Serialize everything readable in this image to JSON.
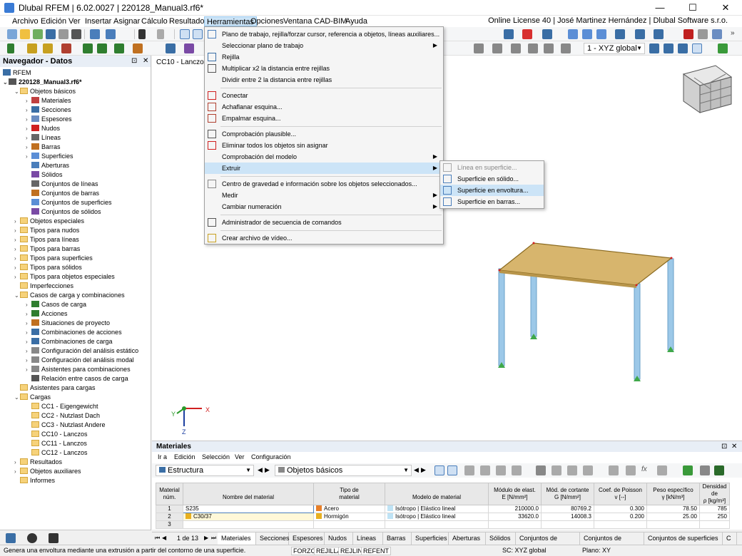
{
  "window": {
    "title": "Dlubal RFEM | 6.02.0027 | 220128_Manual3.rf6*",
    "minimize": "—",
    "maximize": "☐",
    "close": "✕"
  },
  "menubar": {
    "items": [
      "Archivo",
      "Edición",
      "Ver",
      "Insertar",
      "Asignar",
      "Cálculo",
      "Resultados",
      "Herramientas",
      "Opciones",
      "Ventana",
      "CAD-BIM",
      "Ayuda"
    ],
    "license": "Online License 40 | José Martinez Hernández | Dlubal Software s.r.o."
  },
  "toolbar": {
    "coord_system": "1 - XYZ global"
  },
  "navigator": {
    "title": "Navegador - Datos",
    "root": "RFEM",
    "file": "220128_Manual3.rf6*",
    "items": [
      {
        "label": "Objetos básicos",
        "level": 1,
        "exp": "⌄",
        "icon": "folder"
      },
      {
        "label": "Materiales",
        "level": 2,
        "exp": "›",
        "icon": "materials"
      },
      {
        "label": "Secciones",
        "level": 2,
        "exp": "›",
        "icon": "sections"
      },
      {
        "label": "Espesores",
        "level": 2,
        "exp": "›",
        "icon": "thickness"
      },
      {
        "label": "Nudos",
        "level": 2,
        "exp": "›",
        "icon": "node"
      },
      {
        "label": "Líneas",
        "level": 2,
        "exp": "›",
        "icon": "line"
      },
      {
        "label": "Barras",
        "level": 2,
        "exp": "›",
        "icon": "member"
      },
      {
        "label": "Superficies",
        "level": 2,
        "exp": "›",
        "icon": "surface"
      },
      {
        "label": "Aberturas",
        "level": 2,
        "exp": "",
        "icon": "opening"
      },
      {
        "label": "Sólidos",
        "level": 2,
        "exp": "",
        "icon": "solid"
      },
      {
        "label": "Conjuntos de líneas",
        "level": 2,
        "exp": "",
        "icon": "line"
      },
      {
        "label": "Conjuntos de barras",
        "level": 2,
        "exp": "",
        "icon": "member"
      },
      {
        "label": "Conjuntos de superficies",
        "level": 2,
        "exp": "",
        "icon": "surface"
      },
      {
        "label": "Conjuntos de sólidos",
        "level": 2,
        "exp": "",
        "icon": "solid"
      },
      {
        "label": "Objetos especiales",
        "level": 1,
        "exp": "›",
        "icon": "folder"
      },
      {
        "label": "Tipos para nudos",
        "level": 1,
        "exp": "›",
        "icon": "folder"
      },
      {
        "label": "Tipos para líneas",
        "level": 1,
        "exp": "›",
        "icon": "folder"
      },
      {
        "label": "Tipos para barras",
        "level": 1,
        "exp": "›",
        "icon": "folder"
      },
      {
        "label": "Tipos para superficies",
        "level": 1,
        "exp": "›",
        "icon": "folder"
      },
      {
        "label": "Tipos para sólidos",
        "level": 1,
        "exp": "›",
        "icon": "folder"
      },
      {
        "label": "Tipos para objetos especiales",
        "level": 1,
        "exp": "›",
        "icon": "folder"
      },
      {
        "label": "Imperfecciones",
        "level": 1,
        "exp": "",
        "icon": "folder"
      },
      {
        "label": "Casos de carga y combinaciones",
        "level": 1,
        "exp": "⌄",
        "icon": "folder"
      },
      {
        "label": "Casos de carga",
        "level": 2,
        "exp": "›",
        "icon": "loadcase"
      },
      {
        "label": "Acciones",
        "level": 2,
        "exp": "›",
        "icon": "action"
      },
      {
        "label": "Situaciones de proyecto",
        "level": 2,
        "exp": "›",
        "icon": "situation"
      },
      {
        "label": "Combinaciones de acciones",
        "level": 2,
        "exp": "›",
        "icon": "combo"
      },
      {
        "label": "Combinaciones de carga",
        "level": 2,
        "exp": "›",
        "icon": "combo"
      },
      {
        "label": "Configuración del análisis estático",
        "level": 2,
        "exp": "›",
        "icon": "config"
      },
      {
        "label": "Configuración del análisis modal",
        "level": 2,
        "exp": "›",
        "icon": "config"
      },
      {
        "label": "Asistentes para combinaciones",
        "level": 2,
        "exp": "›",
        "icon": "wizard"
      },
      {
        "label": "Relación entre casos de carga",
        "level": 2,
        "exp": "",
        "icon": "relation"
      },
      {
        "label": "Asistentes para cargas",
        "level": 1,
        "exp": "",
        "icon": "folder"
      },
      {
        "label": "Cargas",
        "level": 1,
        "exp": "⌄",
        "icon": "folder"
      },
      {
        "label": "CC1 - Eigengewicht",
        "level": 2,
        "exp": "",
        "icon": "folder"
      },
      {
        "label": "CC2 - Nutzlast Dach",
        "level": 2,
        "exp": "",
        "icon": "folder"
      },
      {
        "label": "CC3 - Nutzlast Andere",
        "level": 2,
        "exp": "",
        "icon": "folder"
      },
      {
        "label": "CC10 - Lanczos",
        "level": 2,
        "exp": "",
        "icon": "folder"
      },
      {
        "label": "CC11 - Lanczos",
        "level": 2,
        "exp": "",
        "icon": "folder"
      },
      {
        "label": "CC12 - Lanczos",
        "level": 2,
        "exp": "",
        "icon": "folder"
      },
      {
        "label": "Resultados",
        "level": 1,
        "exp": "›",
        "icon": "folder"
      },
      {
        "label": "Objetos auxiliares",
        "level": 1,
        "exp": "›",
        "icon": "folder"
      },
      {
        "label": "Informes",
        "level": 1,
        "exp": "",
        "icon": "folder"
      }
    ]
  },
  "viewport": {
    "label": "CC10 - Lanczos",
    "axis_x": "X",
    "axis_y": "Y",
    "axis_z": "Z"
  },
  "tools_menu": {
    "items": [
      {
        "label": "Plano de trabajo, rejilla/forzar cursor, referencia a objetos, líneas auxiliares...",
        "sub": false,
        "icon": "workplane"
      },
      {
        "label": "Seleccionar plano de trabajo",
        "sub": true,
        "icon": ""
      },
      {
        "label": "Rejilla",
        "sub": false,
        "icon": "grid"
      },
      {
        "label": "Multiplicar x2 la distancia entre rejillas",
        "sub": false,
        "icon": "x2"
      },
      {
        "label": "Dividir entre 2 la distancia entre rejillas",
        "sub": false,
        "icon": ""
      },
      {
        "label": "Conectar",
        "sub": false,
        "icon": "connect",
        "sep_before": true
      },
      {
        "label": "Achaflanar esquina...",
        "sub": false,
        "icon": "chamfer"
      },
      {
        "label": "Empalmar esquina...",
        "sub": false,
        "icon": "fillet"
      },
      {
        "label": "Comprobación plausible...",
        "sub": false,
        "icon": "check",
        "sep_before": true
      },
      {
        "label": "Eliminar todos los objetos sin asignar",
        "sub": false,
        "icon": "delete"
      },
      {
        "label": "Comprobación del modelo",
        "sub": true,
        "icon": ""
      },
      {
        "label": "Extruir",
        "sub": true,
        "icon": "",
        "highlight": true
      },
      {
        "label": "Centro de gravedad e información sobre los objetos seleccionados...",
        "sub": false,
        "icon": "cog",
        "sep_before": true
      },
      {
        "label": "Medir",
        "sub": true,
        "icon": ""
      },
      {
        "label": "Cambiar numeración",
        "sub": true,
        "icon": ""
      },
      {
        "label": "Administrador de secuencia de comandos",
        "sub": false,
        "icon": "script",
        "sep_before": true
      },
      {
        "label": "Crear archivo de vídeo...",
        "sub": false,
        "icon": "video",
        "sep_before": true
      }
    ]
  },
  "extrude_submenu": {
    "items": [
      {
        "label": "Línea en superficie...",
        "disabled": true
      },
      {
        "label": "Superficie en sólido...",
        "disabled": false
      },
      {
        "label": "Superficie en envoltura...",
        "disabled": false,
        "highlight": true
      },
      {
        "label": "Superficie en barras...",
        "disabled": false
      }
    ]
  },
  "materials": {
    "title": "Materiales",
    "menu": [
      "Ir a",
      "Edición",
      "Selección",
      "Ver",
      "Configuración"
    ],
    "combo_left": "Estructura",
    "combo_right": "Objetos básicos",
    "headers": [
      [
        "Material",
        "núm."
      ],
      [
        "",
        "Nombre del material"
      ],
      [
        "Tipo de",
        "material"
      ],
      [
        "",
        "Modelo de material"
      ],
      [
        "Módulo de elast.",
        "E [N/mm²]"
      ],
      [
        "Mód. de cortante",
        "G [N/mm²]"
      ],
      [
        "Coef. de Poisson",
        "v [--]"
      ],
      [
        "Peso específico",
        "γ [kN/m³]"
      ],
      [
        "Densidad de",
        "ρ [kg/m³]"
      ]
    ],
    "rows": [
      {
        "num": "1",
        "name": "S235",
        "name_color": "",
        "type": "Acero",
        "type_color": "#e8802a",
        "model": "Isótropo | Elástico lineal",
        "E": "210000.0",
        "G": "80769.2",
        "v": "0.300",
        "gamma": "78.50",
        "rho": "785"
      },
      {
        "num": "2",
        "name": "C30/37",
        "name_color": "#e8b020",
        "type": "Hormigón",
        "type_color": "#e8b020",
        "model": "Isótropo | Elástico lineal",
        "E": "33620.0",
        "G": "14008.3",
        "v": "0.200",
        "gamma": "25.00",
        "rho": "250"
      },
      {
        "num": "3",
        "name": "",
        "name_color": "",
        "type": "",
        "type_color": "",
        "model": "",
        "E": "",
        "G": "",
        "v": "",
        "gamma": "",
        "rho": ""
      }
    ]
  },
  "tabs": {
    "pager": "1 de 13",
    "items": [
      "Materiales",
      "Secciones",
      "Espesores",
      "Nudos",
      "Líneas",
      "Barras",
      "Superficies",
      "Aberturas",
      "Sólidos",
      "Conjuntos de líneas",
      "Conjuntos de barras",
      "Conjuntos de superficies",
      "C"
    ]
  },
  "statusbar": {
    "message": "Genera una envoltura mediante una extrusión a partir del contorno de una superficie.",
    "toggles": [
      "FORZC",
      "REJILLA",
      "REJLIN",
      "REFENT"
    ],
    "cs": "SC: XYZ global",
    "plane": "Plano: XY"
  }
}
